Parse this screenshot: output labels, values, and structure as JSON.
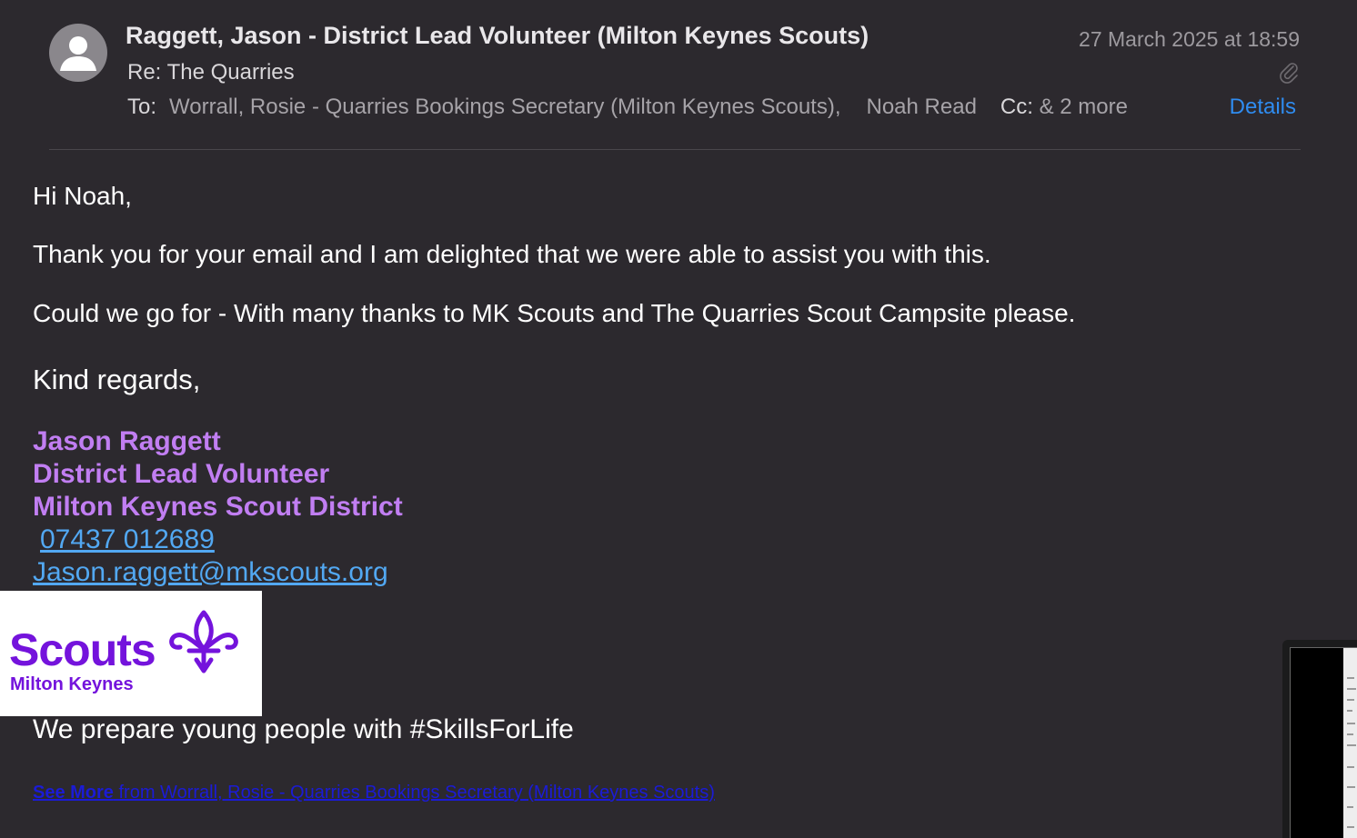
{
  "header": {
    "sender": "Raggett, Jason - District Lead Volunteer (Milton Keynes Scouts)",
    "date": "27 March 2025 at 18:59",
    "subject": "Re: The Quarries",
    "to_label": "To:",
    "recipients": [
      "Worrall, Rosie - Quarries Bookings Secretary (Milton Keynes Scouts),",
      "Noah Read"
    ],
    "cc_label": "Cc:",
    "cc_more": "& 2 more",
    "details_label": "Details",
    "icons": {
      "avatar": "person-avatar-icon",
      "attachment": "paperclip-icon"
    }
  },
  "body": {
    "greeting": "Hi Noah,",
    "thanks": "Thank you for your email and I am delighted that we were able to assist you with this.",
    "credit": "Could we go for - With many thanks to MK Scouts and The Quarries Scout Campsite please.",
    "regards": "Kind regards,"
  },
  "signature": {
    "name": "Jason Raggett",
    "role": "District Lead Volunteer",
    "district": "Milton Keynes Scout District",
    "phone": "07437 012689",
    "email": "Jason.raggett@mkscouts.org",
    "logo_word": "Scouts",
    "logo_sub": "Milton Keynes",
    "motto": "We prepare young people with #SkillsForLife"
  },
  "footer": {
    "see_more_bold": "See More",
    "see_more_rest": " from Worrall, Rosie - Quarries Bookings Secretary (Milton Keynes Scouts)"
  },
  "colors": {
    "background": "#2c292e",
    "signature_purple": "#c17ef2",
    "link_blue": "#52a8f2",
    "details_blue": "#2f8cf0",
    "scouts_purple": "#7413dc"
  }
}
